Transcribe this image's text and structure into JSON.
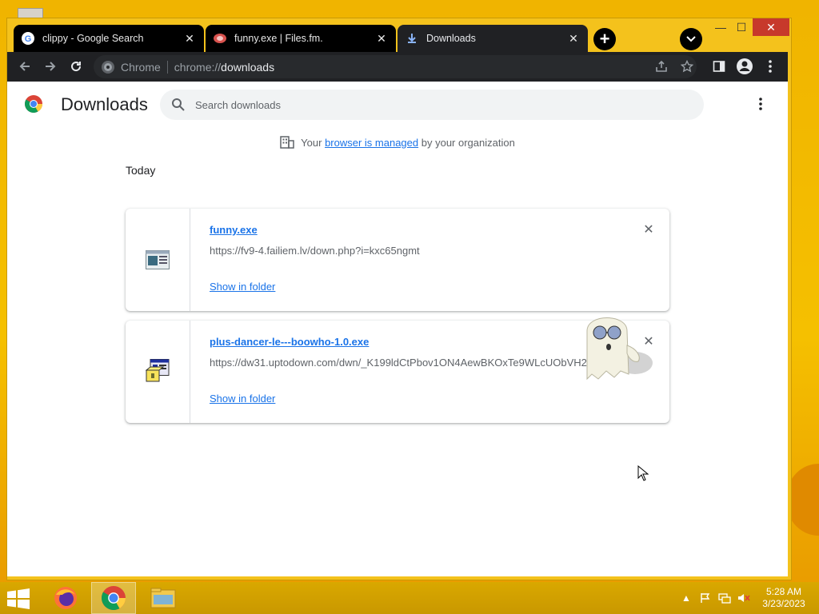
{
  "browser": {
    "tabs": [
      {
        "title": "clippy - Google Search",
        "icon": "google-icon",
        "active": false
      },
      {
        "title": "funny.exe | Files.fm.",
        "icon": "filesfm-icon",
        "active": false
      },
      {
        "title": "Downloads",
        "icon": "download-icon",
        "active": true
      }
    ],
    "new_tab_symbol": "+",
    "omnibox": {
      "chip_label": "Chrome",
      "url_scheme": "chrome://",
      "url_host": "downloads"
    }
  },
  "page": {
    "title": "Downloads",
    "search_placeholder": "Search downloads",
    "managed_notice": {
      "prefix": "Your",
      "link": "browser is managed",
      "suffix": "by your organization"
    },
    "section_label": "Today",
    "downloads": [
      {
        "file_name": "funny.exe",
        "url": "https://fv9-4.failiem.lv/down.php?i=kxc65ngmt",
        "action": "Show in folder",
        "icon": "exe-window-icon"
      },
      {
        "file_name": "plus-dancer-le---boowho-1.0.exe",
        "url": "https://dw31.uptodown.com/dwn/_K199ldCtPbov1ON4AewBKOxTe9WLcUObVH2y",
        "action": "Show in folder",
        "icon": "installer-icon"
      }
    ]
  },
  "taskbar": {
    "apps": [
      "firefox-icon",
      "chrome-icon",
      "file-explorer-icon"
    ],
    "clock": {
      "time": "5:28 AM",
      "date": "3/23/2023"
    }
  },
  "colors": {
    "desktop": "#f4c21c",
    "link": "#1a73e8",
    "toolbar": "#202124"
  }
}
